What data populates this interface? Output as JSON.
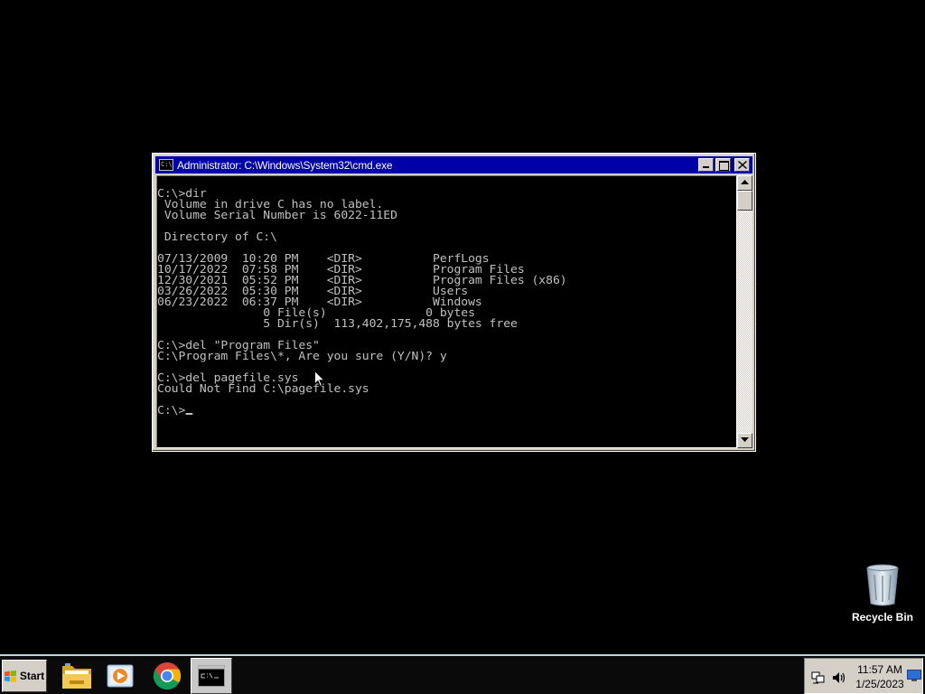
{
  "window": {
    "title": "Administrator: C:\\Windows\\System32\\cmd.exe",
    "icon_text": "C:\\_"
  },
  "console": {
    "lines": [
      "C:\\>dir",
      " Volume in drive C has no label.",
      " Volume Serial Number is 6022-11ED",
      "",
      " Directory of C:\\",
      "",
      "07/13/2009  10:20 PM    <DIR>          PerfLogs",
      "10/17/2022  07:58 PM    <DIR>          Program Files",
      "12/30/2021  05:52 PM    <DIR>          Program Files (x86)",
      "03/26/2022  05:30 PM    <DIR>          Users",
      "06/23/2022  06:37 PM    <DIR>          Windows",
      "               0 File(s)              0 bytes",
      "               5 Dir(s)  113,402,175,488 bytes free",
      "",
      "C:\\>del \"Program Files\"",
      "C:\\Program Files\\*, Are you sure (Y/N)? y",
      "",
      "C:\\>del pagefile.sys",
      "Could Not Find C:\\pagefile.sys",
      ""
    ],
    "prompt": "C:\\>"
  },
  "desktop": {
    "recycle_bin_label": "Recycle Bin"
  },
  "taskbar": {
    "start_label": "Start",
    "apps": [
      "file-explorer",
      "media-player",
      "chrome",
      "command-prompt"
    ],
    "clock_time": "11:57 AM",
    "clock_date": "1/25/2023"
  },
  "colors": {
    "title_bar": "#0000a8",
    "console_bg": "#000000",
    "console_fg": "#c0c0c0",
    "desktop_bg": "#000000"
  }
}
